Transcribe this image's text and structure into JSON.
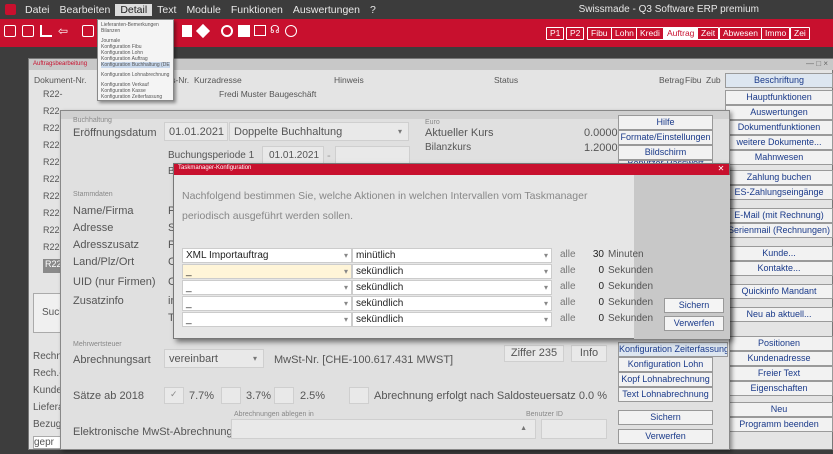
{
  "menubar": {
    "items": [
      {
        "label": "Datei",
        "u": "D"
      },
      {
        "label": "Bearbeiten",
        "u": "B"
      },
      {
        "label": "Detail",
        "u": ""
      },
      {
        "label": "Text",
        "u": ""
      },
      {
        "label": "Module",
        "u": "M"
      },
      {
        "label": "Funktionen",
        "u": "F"
      },
      {
        "label": "Auswertungen",
        "u": "A"
      },
      {
        "label": "?",
        "u": ""
      }
    ],
    "app_title": "Swissmade - Q3 Software ERP premium"
  },
  "toolbar": {
    "buttons": [
      "P1",
      "P2",
      "Fibu",
      "Lohn",
      "Kredi",
      "Auftrag",
      "Zeit",
      "Abwesen",
      "Immo",
      "Zei"
    ],
    "highlighted": "Auftrag"
  },
  "detail_menu": {
    "items": [
      "Lieferanten-Bemerkungen",
      "Bilanzen",
      "",
      "Journale",
      "Konfiguration Fibu",
      "Konfiguration Lohn",
      "Konfiguration Auftrag",
      "Konfiguration Buchhaltung (DE)",
      "",
      "Konfiguration Lohnabrechnung",
      "",
      "Konfiguration Verkauf",
      "Konfiguration Kasse",
      "Konfiguration Zeiterfassung"
    ],
    "selected_index": 7
  },
  "main_window": {
    "title": "Auftragsbearbeitung",
    "list_headers": [
      "Dokument-Nr.",
      "Adress-Nr.",
      "Kurzadresse",
      "Hinweis",
      "Status",
      "Betrag",
      "Fibu",
      "Zub"
    ],
    "row_fragment": "Fredi Muster Baugeschäft",
    "rows": [
      "R22-",
      "R22-",
      "R22-",
      "R22-",
      "R22",
      "R22",
      "R22-",
      "R22-",
      "R22-",
      "R22-",
      "R22-"
    ],
    "selected_row": "R22-",
    "side_buttons": [
      "Beschriftung",
      "Hauptfunktionen",
      "Auswertungen",
      "Dokumentfunktionen",
      "weitere Dokumente...",
      "Mahnwesen",
      "",
      "Zahlung buchen",
      "ES-Zahlungseingänge",
      "",
      "E-Mail (mit Rechnung)",
      "Serienmail (Rechnungen)",
      "",
      "Kunde...",
      "Kontakte...",
      "",
      "Quickinfo Mandant",
      "",
      "Neu ab aktuell...",
      "",
      "Positionen",
      "Kundenadresse",
      "Freier Text",
      "Eigenschaften",
      "",
      "Neu",
      "Programm beenden"
    ],
    "left_labels": [
      "Such",
      "Rechnu",
      "Rech.-I",
      "Kunde",
      "Liefera",
      "Bezugs",
      "gepr"
    ]
  },
  "param_window": {
    "buchhaltung_small": "Buchhaltung",
    "eroeffnungsdatum_label": "Eröffnungsdatum",
    "eroeffnungsdatum": "01.01.2021",
    "buchhaltung_type": "Doppelte Buchhaltung",
    "buchungsperiode_label": "Buchungsperiode 1",
    "buchungsperiode": "01.01.2021",
    "bu_fragment": "Bu",
    "euro_small": "Euro",
    "aktueller_kurs_label": "Aktueller Kurs",
    "aktueller_kurs": "0.0000000",
    "bilanzkurs_label": "Bilanzkurs",
    "bilanzkurs": "1.2000000",
    "stammdaten_small": "Stammdaten",
    "stamm_labels": [
      "Name/Firma",
      "Adresse",
      "Adresszusatz",
      "Land/Plz/Ort",
      "UID (nur Firmen)",
      "Zusatzinfo"
    ],
    "stamm_fragments": [
      "P",
      "Si",
      "P",
      "C",
      "C",
      "in",
      "Te"
    ],
    "mwst_small": "Mehrwertsteuer",
    "abrechnungsart_label": "Abrechnungsart",
    "abrechnungsart": "vereinbart",
    "mwst_nr": "MwSt-Nr. [CHE-100.617.431 MWST]",
    "ziffer": "Ziffer 235",
    "info": "Info",
    "saetze_label": "Sätze ab 2018",
    "rate1": "7.7%",
    "rate2": "3.7%",
    "rate3": "2.5%",
    "saldo_text": "Abrechnung erfolgt nach Saldosteuersatz",
    "saldo_rate": "0.0 %",
    "ablegen_small": "Abrechnungen ablegen in",
    "benutzer_small": "Benutzer ID",
    "elektronisch_label": "Elektronische MwSt-Abrechnung",
    "right_buttons": [
      "Hilfe",
      "Formate/Einstellungen",
      "Bildschirm",
      "Benutzer-Passwort",
      "Konfiguration Zeiterfassung",
      "Konfiguration Lohn",
      "Kopf Lohnabrechnung",
      "Text Lohnabrechnung",
      "Sichern",
      "Verwerfen"
    ]
  },
  "task_dialog": {
    "title": "Taskmanager-Konfiguration",
    "description": "Nachfolgend bestimmen Sie, welche Aktionen in welchen Intervallen vom Taskmanager periodisch ausgeführt werden sollen.",
    "rows": [
      {
        "action": "XML Importauftrag",
        "interval": "minütlich",
        "alle": "alle",
        "count": "30",
        "unit": "Minuten"
      },
      {
        "action": "_",
        "interval": "sekündlich",
        "alle": "alle",
        "count": "0",
        "unit": "Sekunden"
      },
      {
        "action": "_",
        "interval": "sekündlich",
        "alle": "alle",
        "count": "0",
        "unit": "Sekunden"
      },
      {
        "action": "_",
        "interval": "sekündlich",
        "alle": "alle",
        "count": "0",
        "unit": "Sekunden"
      },
      {
        "action": "_",
        "interval": "sekündlich",
        "alle": "alle",
        "count": "0",
        "unit": "Sekunden"
      }
    ],
    "sichern": "Sichern",
    "verwerfen": "Verwerfen"
  }
}
